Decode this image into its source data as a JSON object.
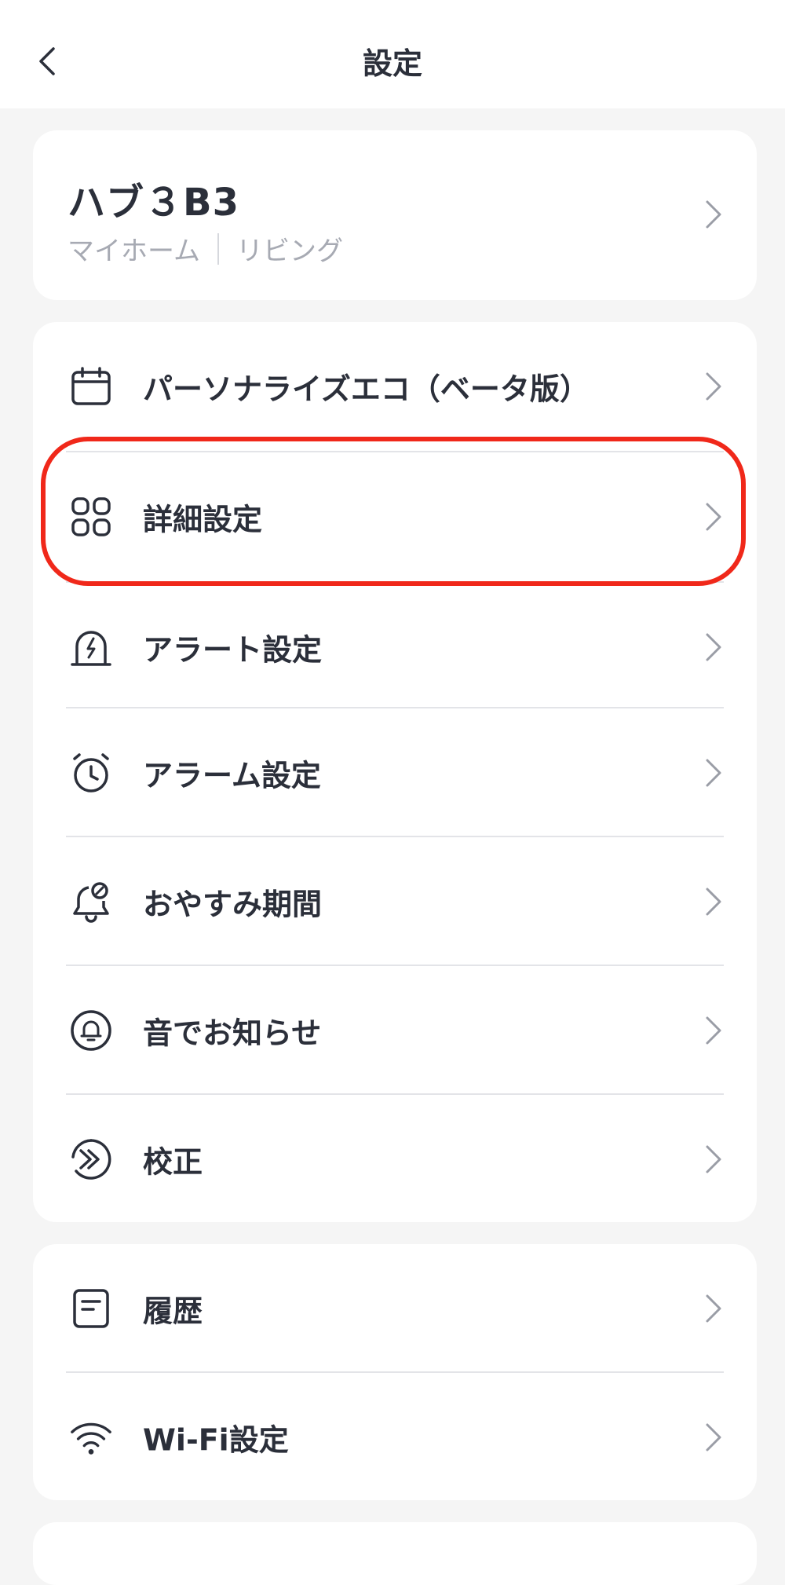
{
  "header": {
    "title": "設定",
    "back_icon": "chevron-left-icon"
  },
  "device": {
    "name": "ハブ３B3",
    "home": "マイホーム",
    "room": "リビング"
  },
  "menu_group_1": [
    {
      "label": "パーソナライズエコ（ベータ版）",
      "icon": "calendar-icon"
    },
    {
      "label": "詳細設定",
      "icon": "grid-icon",
      "highlighted": true
    },
    {
      "label": "アラート設定",
      "icon": "alert-siren-icon"
    },
    {
      "label": "アラーム設定",
      "icon": "alarm-clock-icon"
    },
    {
      "label": "おやすみ期間",
      "icon": "bell-off-icon"
    },
    {
      "label": "音でお知らせ",
      "icon": "sound-bell-icon"
    },
    {
      "label": "校正",
      "icon": "calibrate-icon"
    }
  ],
  "menu_group_2": [
    {
      "label": "履歴",
      "icon": "history-doc-icon"
    },
    {
      "label": "Wi-Fi設定",
      "icon": "wifi-icon"
    }
  ],
  "colors": {
    "highlight": "#f0281a",
    "text": "#2b2f3a",
    "subtext": "#a7aab3",
    "background": "#f5f5f5"
  }
}
